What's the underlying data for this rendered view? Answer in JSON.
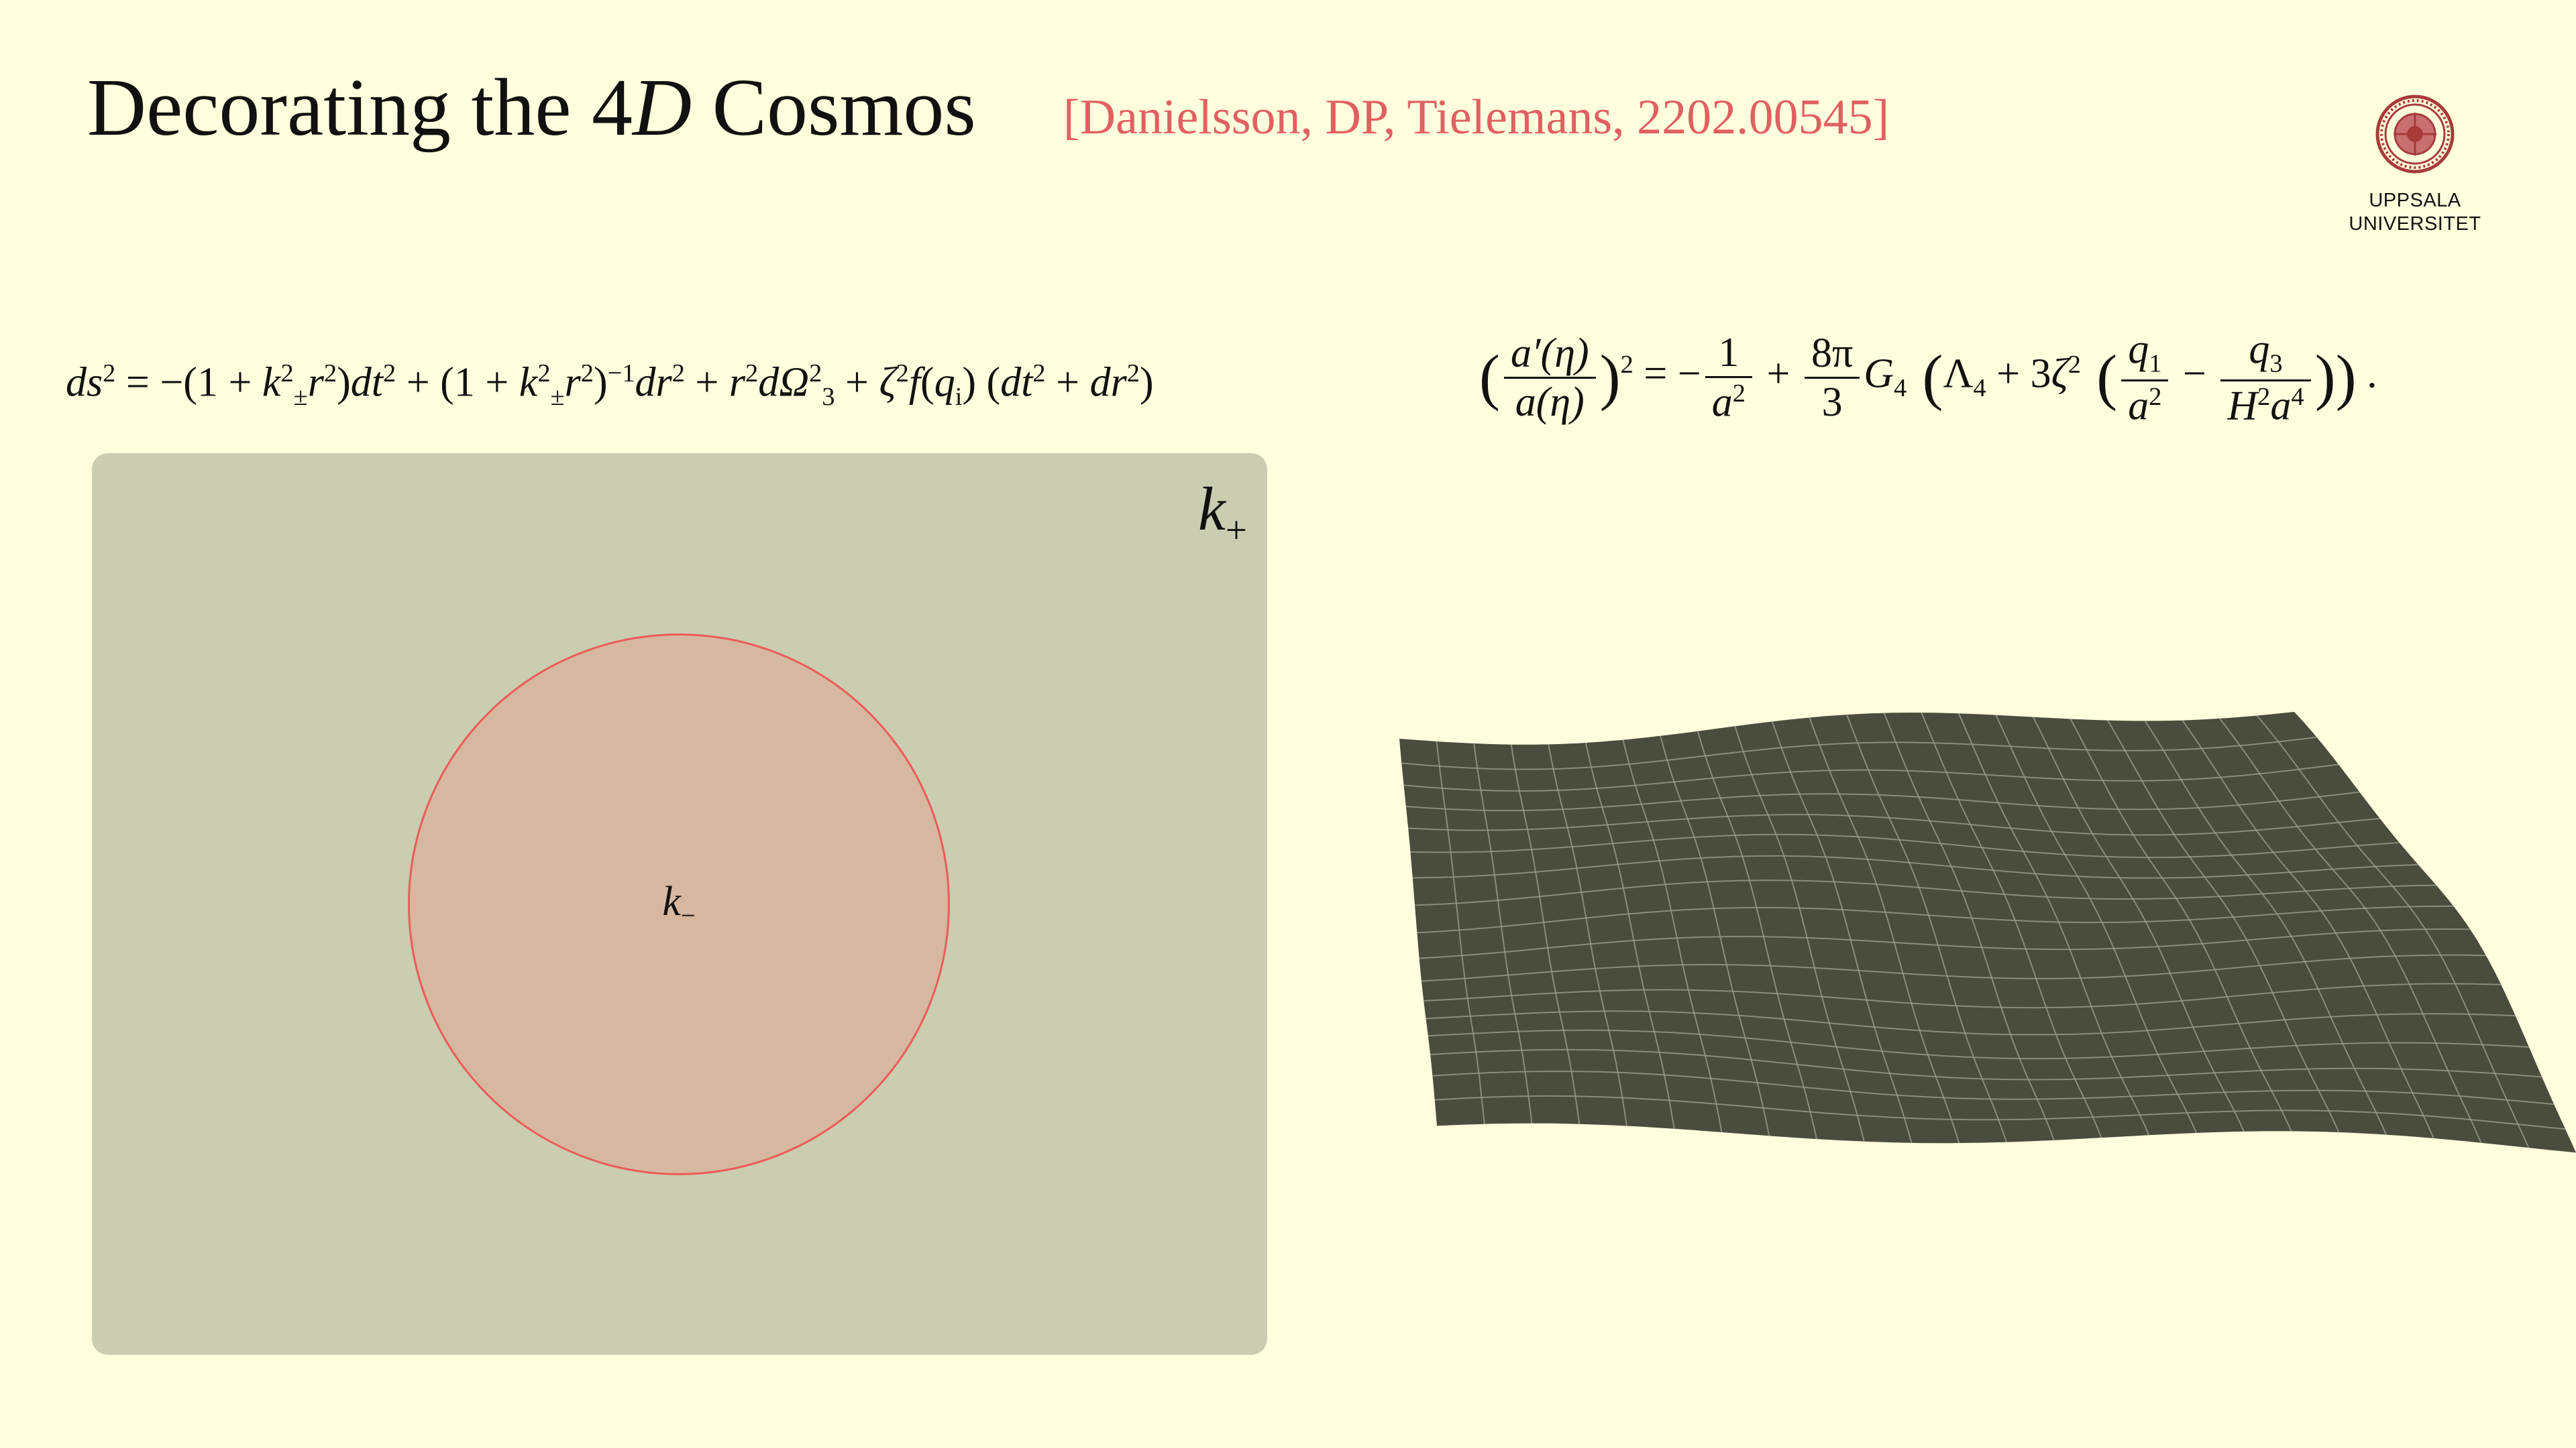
{
  "slide": {
    "title_text": "Decorating the 4",
    "title_math": "D",
    "title_rest": " Cosmos",
    "citation": "[Danielsson, DP, Tielemans, 2202.00545]"
  },
  "logo": {
    "line1": "UPPSALA",
    "line2": "UNIVERSITET"
  },
  "equations": {
    "metric": {
      "p1": "ds",
      "p2": "2",
      "p3": " = −(1 + ",
      "p4": "k",
      "p5": "2",
      "p6": "±",
      "p7": "r",
      "p8": "2",
      "p9": ")",
      "p10": "dt",
      "p11": "2",
      "p12": " + (1 + ",
      "p13": "k",
      "p14": "2",
      "p15": "±",
      "p16": "r",
      "p17": "2",
      "p18": ")",
      "p19": "−1",
      "p20": "dr",
      "p21": "2",
      "p22": " + ",
      "p23": "r",
      "p24": "2",
      "p25": "dΩ",
      "p26": "2",
      "p27": "3",
      "p28": " + ",
      "p29": "ζ",
      "p30": "2",
      "p31": "f",
      "p32": "(",
      "p33": "q",
      "p34": "i",
      "p35": ") (",
      "p36": "dt",
      "p37": "2",
      "p38": " + ",
      "p39": "dr",
      "p40": "2",
      "p41": ")"
    },
    "friedmann": {
      "open": "(",
      "num1": "a′(η)",
      "den1": "a(η)",
      "close": ")",
      "pow": "2",
      "eqminus": " = −",
      "num2": "1",
      "den2a": "a",
      "den2b": "2",
      "plus1": " + ",
      "num3": "8π",
      "den3": "3",
      "g": "G",
      "gsub": "4",
      "open2": " (",
      "lambda": "Λ",
      "lambdasub": "4",
      "plus2": " + 3",
      "zeta": "ζ",
      "zetapow": "2",
      "open3": " (",
      "num4a": "q",
      "num4b": "1",
      "den4a": "a",
      "den4b": "2",
      "minus": " − ",
      "num5a": "q",
      "num5b": "3",
      "den5a": "H",
      "den5b": "2",
      "den5c": "a",
      "den5d": "4",
      "close3": ")",
      "close2": ")",
      "period": " ."
    }
  },
  "diagram": {
    "outer_label": "k",
    "outer_sub": "+",
    "inner_label": "k",
    "inner_sub": "−"
  },
  "colors": {
    "background": "#FFFFDD",
    "citation": "#E06060",
    "panel": "#CACDB0",
    "bubble_fill": "#D6B8A0",
    "bubble_stroke": "#EE5A5A",
    "surface": "#4A4C3E",
    "logo": "#A83A3A"
  }
}
